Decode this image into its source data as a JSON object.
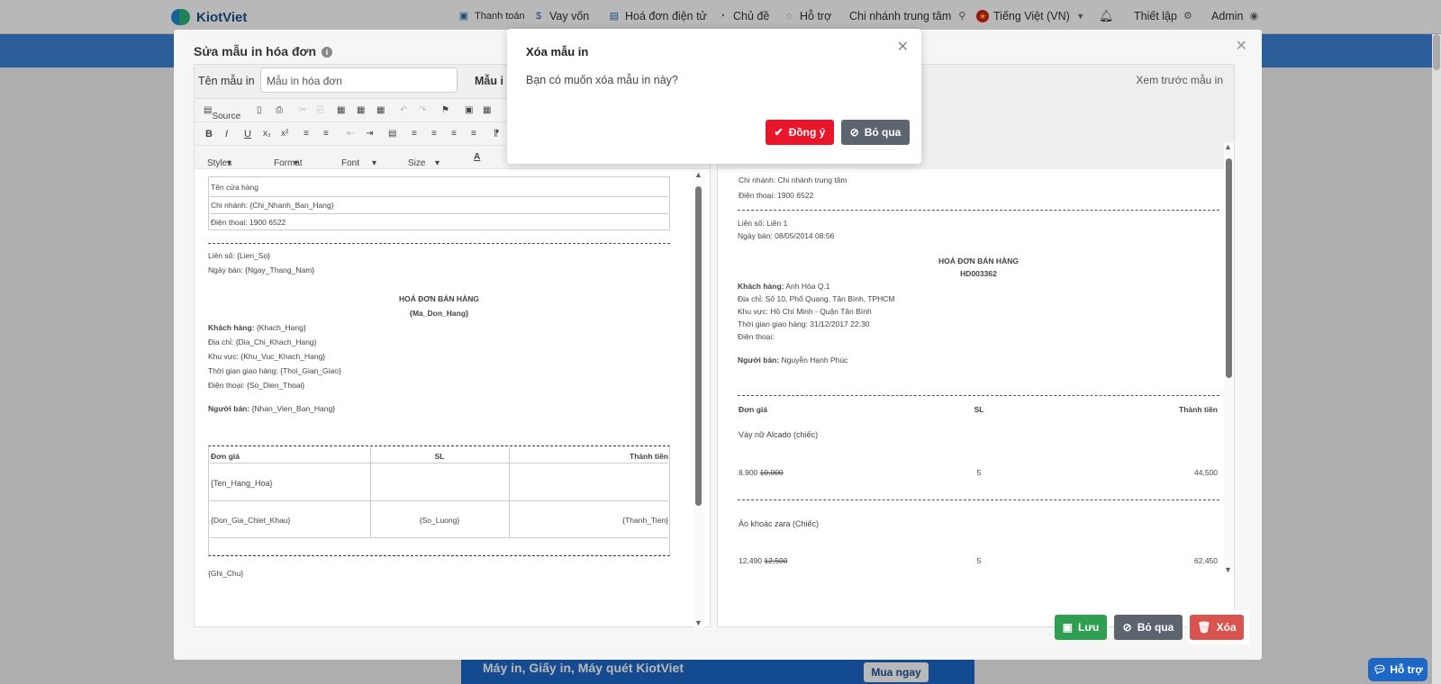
{
  "topbar": {
    "logo": "KiotViet",
    "nav": [
      {
        "label": "Thanh toán",
        "icon": "payment-icon"
      },
      {
        "label": "Vay vốn",
        "icon": "money-bag-icon"
      },
      {
        "label": "Hoá đơn điện tử",
        "icon": "invoice-icon"
      },
      {
        "label": "Chủ đề",
        "icon": "palette-icon"
      },
      {
        "label": "Hỗ trợ",
        "icon": "chat-icon"
      },
      {
        "label": "Chi nhánh trung tâm",
        "icon": "location-pin-icon"
      },
      {
        "label": "Tiếng Việt (VN)",
        "icon": "vietnam-flag-icon"
      },
      {
        "label": "Thiết lập",
        "icon": "gear-icon"
      },
      {
        "label": "Admin",
        "icon": "user-icon"
      }
    ]
  },
  "editor": {
    "title": "Sửa mẫu in hóa đơn",
    "name_label": "Tên mẫu in",
    "name_value": "Mẫu in hóa đơn",
    "paper_label": "Mẫu i",
    "toolbar": {
      "source": "Source",
      "styles": "Styles",
      "format": "Format",
      "font": "Font",
      "size": "Size"
    },
    "template": {
      "store_name": "Tên cửa hàng",
      "branch": "Chi nhánh: {Chi_Nhanh_Ban_Hang}",
      "phone": "Điện thoại: 1900 6522",
      "copy": "Liên số: {Lien_So}",
      "date": "Ngày bán: {Ngay_Thang_Nam}",
      "heading": "HOÁ ĐƠN BÁN HÀNG",
      "code": "{Ma_Don_Hang}",
      "customer_label": "Khách hàng:",
      "customer": "{Khach_Hang}",
      "address": "Địa chỉ: {Dia_Chi_Khach_Hang}",
      "area": "Khu vực: {Khu_Vuc_Khach_Hang}",
      "delivery": "Thời gian giao hàng: {Thoi_Gian_Giao}",
      "cust_phone": "Điện thoại: {So_Dien_Thoai}",
      "seller_label": "Người bán:",
      "seller": "{Nhan_Vien_Ban_Hang}",
      "col_price": "Đơn giá",
      "col_qty": "SL",
      "col_total": "Thành tiền",
      "product": "{Ten_Hang_Hoa}",
      "price_var": "{Don_Gia_Chiet_Khau}",
      "qty_var": "{So_Luong}",
      "total_var": "{Thanh_Tien}",
      "note": "{Ghi_Chu}"
    },
    "preview": {
      "header": "Xem trước mẫu in",
      "branch": "Chi nhánh: Chi nhánh trung tâm",
      "phone": "Điện thoại: 1900 6522",
      "copy": "Liên số: Liên 1",
      "date": "Ngày bán: 08/05/2014 08:56",
      "heading": "HOÁ ĐƠN BÁN HÀNG",
      "code": "HD003362",
      "customer_label": "Khách hàng:",
      "customer": "Anh Hòa Q.1",
      "address": "Địa chỉ: Số 10, Phổ Quang, Tân Bình, TPHCM",
      "area": "Khu vực: Hồ Chí Minh - Quận Tân Bình",
      "delivery": "Thời gian giao hàng: 31/12/2017 22:30",
      "cust_phone": "Điện thoại:",
      "seller_label": "Người bán:",
      "seller": "Nguyễn Hạnh Phúc",
      "col_price": "Đơn giá",
      "col_qty": "SL",
      "col_total": "Thành tiền",
      "items": [
        {
          "name": "Váy nữ Alcado (chiếc)",
          "price": "8,900",
          "old_price": "10,000",
          "qty": "5",
          "total": "44,500"
        },
        {
          "name": "Áo khoác zara (Chiếc)",
          "price": "12,490",
          "old_price": "12,500",
          "qty": "5",
          "total": "62,450"
        }
      ]
    },
    "buttons": {
      "save": "Lưu",
      "cancel": "Bỏ qua",
      "delete": "Xóa"
    }
  },
  "dialog": {
    "title": "Xóa mẫu in",
    "message": "Bạn có muốn xóa mẫu in này?",
    "confirm": "Đồng ý",
    "cancel": "Bỏ qua"
  },
  "banner": {
    "text": "Máy in, Giấy in, Máy quét KiotViet",
    "button": "Mua ngay"
  },
  "help_fab": "Hỗ trợ",
  "colors": {
    "brand_blue": "#3b82d6",
    "confirm_red": "#e8152b",
    "save_green": "#2e9e4f",
    "cancel_gray": "#5c6470",
    "delete_red": "#d9534f"
  }
}
